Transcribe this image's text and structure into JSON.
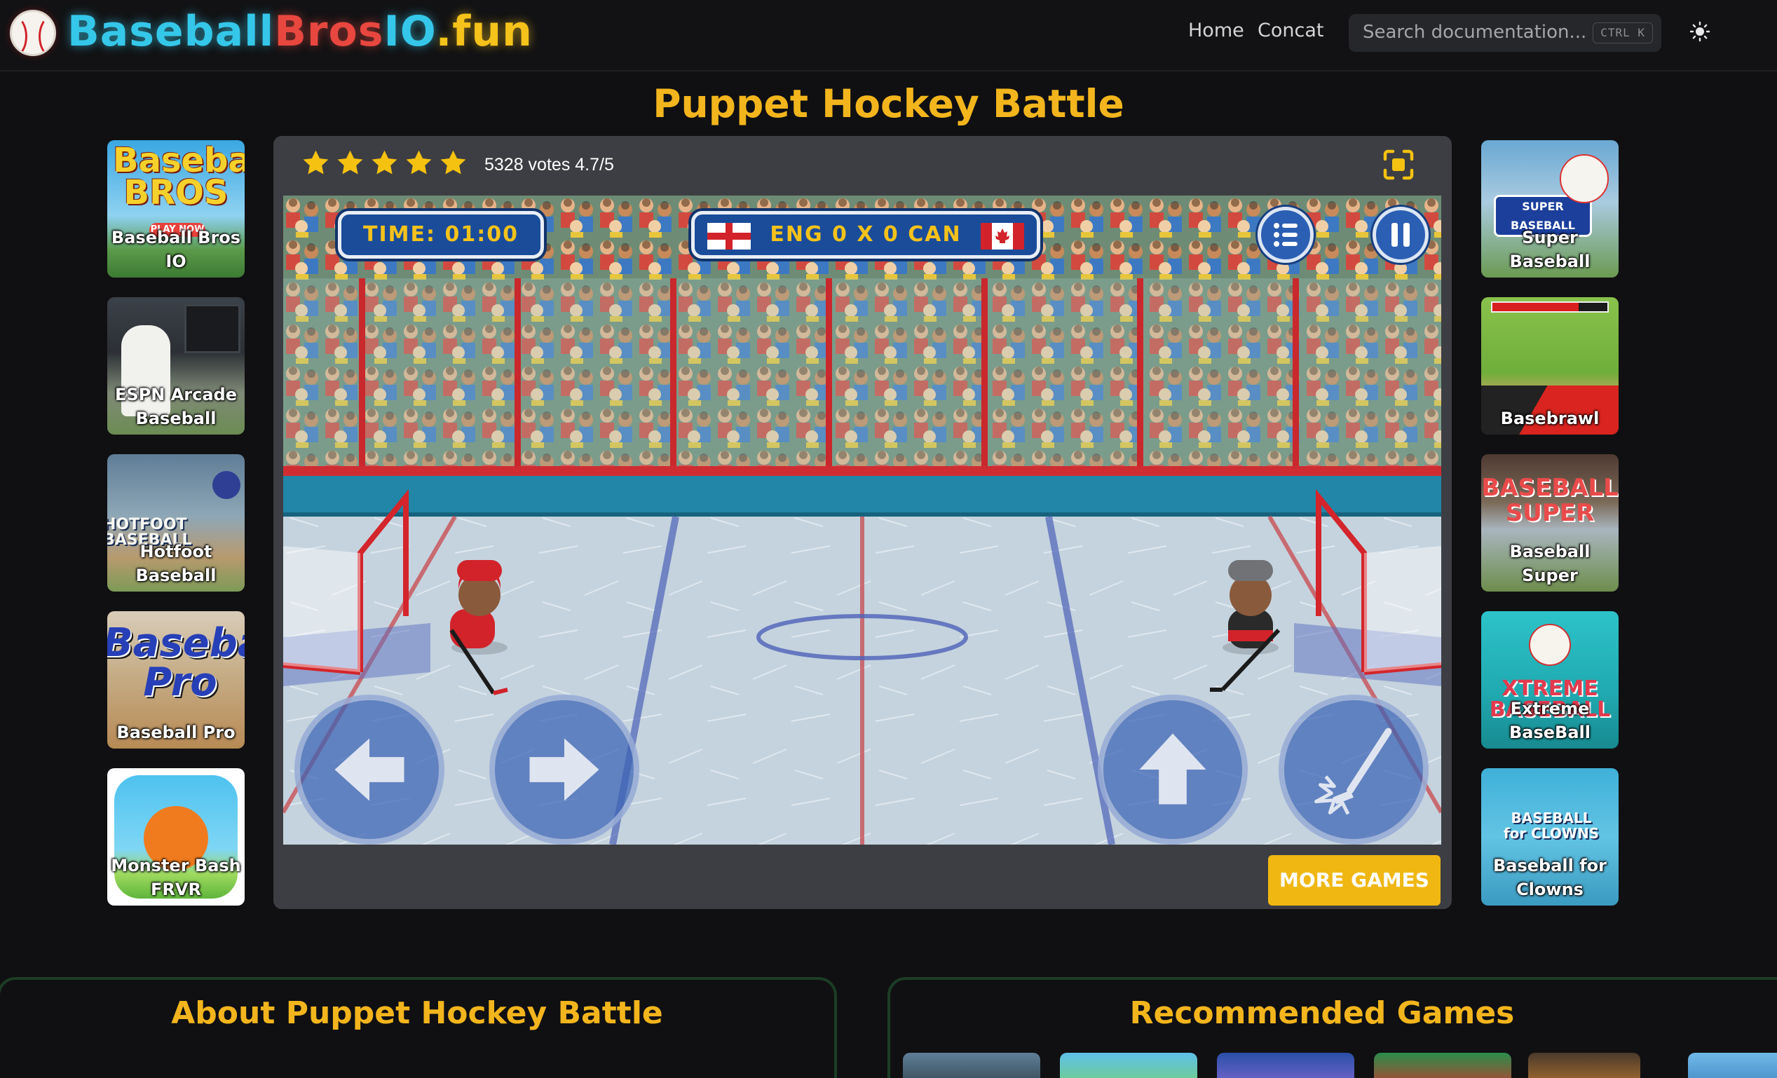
{
  "header": {
    "logo_part1": "Baseball",
    "logo_part2": "Bros",
    "logo_part3": "IO",
    "logo_part4": ".fun",
    "nav": {
      "home": "Home",
      "contact": "Concat"
    },
    "search": {
      "placeholder": "Search documentation...",
      "shortcut": "CTRL K"
    },
    "theme_icon": "sun-icon"
  },
  "page": {
    "title": "Puppet Hockey Battle"
  },
  "left_games": [
    {
      "title": "Baseball Bros IO",
      "thumb_text": "Baseball BROS",
      "badge": "PLAY NOW"
    },
    {
      "title": "ESPN Arcade Baseball"
    },
    {
      "title": "Hotfoot Baseball",
      "thumb_text": "HOTFOOT BASEBALL"
    },
    {
      "title": "Baseball Pro",
      "thumb_text": "Baseball Pro"
    },
    {
      "title": "Monster Bash FRVR"
    }
  ],
  "right_games": [
    {
      "title": "Super Baseball",
      "thumb_text": "SUPER BASEBALL"
    },
    {
      "title": "Basebrawl"
    },
    {
      "title": "Baseball Super",
      "thumb_text": "BASEBALL SUPER"
    },
    {
      "title": "Extreme BaseBall",
      "thumb_text": "XTREME BASEBALL"
    },
    {
      "title": "Baseball for Clowns",
      "thumb_text": "BASEBALL for CLOWNS"
    }
  ],
  "rating": {
    "stars": 5,
    "votes_text": "5328 votes 4.7/5"
  },
  "game": {
    "timer_text": "TIME:   01:00",
    "score_text": "ENG 0 X 0 CAN",
    "team_left": "ENG",
    "team_right": "CAN",
    "controls": [
      "arrow-left-icon",
      "arrow-right-icon",
      "arrow-up-icon",
      "shoot-stick-icon"
    ]
  },
  "more_games_label": "MORE GAMES",
  "about": {
    "title": "About Puppet Hockey Battle"
  },
  "recommended": {
    "title": "Recommended Games"
  },
  "colors": {
    "accent": "#f3b51d",
    "panel": "#3d3e43",
    "button": "#f0b713",
    "logo_blue": "#35c7e9",
    "logo_red": "#e8473f"
  }
}
